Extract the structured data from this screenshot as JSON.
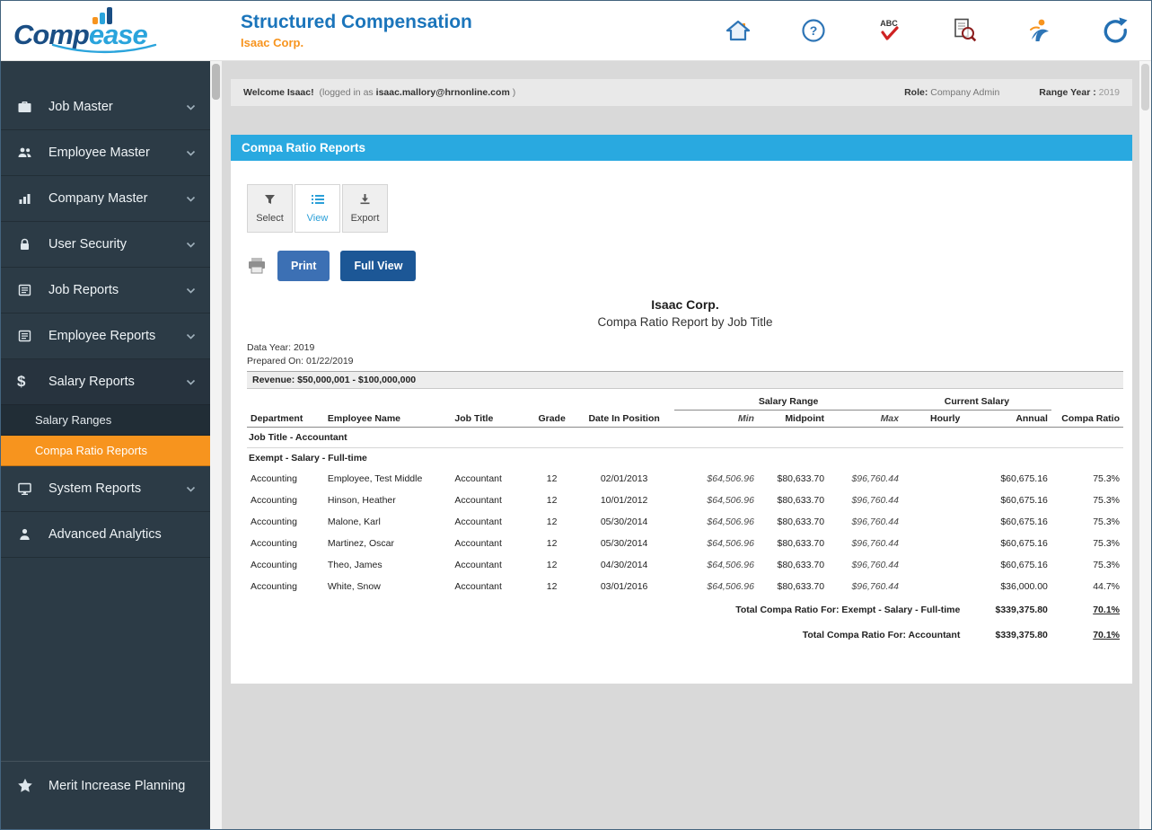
{
  "header": {
    "logo_part1": "Comp",
    "logo_part2": "ease",
    "app_title": "Structured Compensation",
    "company": "Isaac Corp."
  },
  "icons": {
    "dollar_glyph": "$",
    "question_glyph": "?",
    "abc_glyph": "ABC"
  },
  "sidebar": {
    "items": [
      {
        "label": "Job Master",
        "icon": "briefcase-icon"
      },
      {
        "label": "Employee Master",
        "icon": "people-icon"
      },
      {
        "label": "Company Master",
        "icon": "bar-chart-icon"
      },
      {
        "label": "User Security",
        "icon": "lock-icon"
      },
      {
        "label": "Job Reports",
        "icon": "report-icon"
      },
      {
        "label": "Employee Reports",
        "icon": "report-icon"
      },
      {
        "label": "Salary Reports",
        "icon": "dollar-icon",
        "expanded": true,
        "children": [
          {
            "label": "Salary Ranges",
            "active": false
          },
          {
            "label": "Compa Ratio Reports",
            "active": true
          }
        ]
      },
      {
        "label": "System Reports",
        "icon": "monitor-icon"
      },
      {
        "label": "Advanced Analytics",
        "icon": "person-icon"
      }
    ],
    "footer_item": {
      "label": "Merit Increase Planning",
      "icon": "star-icon"
    }
  },
  "welcome_bar": {
    "welcome": "Welcome Isaac!",
    "logged_in_prefix": "(logged in as",
    "email": "isaac.mallory@hrnonline.com",
    "logged_in_suffix": ")",
    "role_label": "Role:",
    "role_value": "Company Admin",
    "range_year_label": "Range Year :",
    "range_year_value": "2019"
  },
  "page": {
    "title": "Compa Ratio Reports",
    "tabs": [
      {
        "label": "Select",
        "icon": "filter-icon",
        "active": false
      },
      {
        "label": "View",
        "icon": "list-icon",
        "active": true
      },
      {
        "label": "Export",
        "icon": "download-icon",
        "active": false
      }
    ],
    "print_button": "Print",
    "full_view_button": "Full View"
  },
  "report": {
    "company": "Isaac Corp.",
    "title": "Compa Ratio Report by Job Title",
    "data_year": "Data Year: 2019",
    "prepared_on": "Prepared On: 01/22/2019",
    "revenue_band": "Revenue: $50,000,001 - $100,000,000",
    "group_headers": {
      "salary_range": "Salary Range",
      "current_salary": "Current Salary"
    },
    "columns": [
      "Department",
      "Employee Name",
      "Job Title",
      "Grade",
      "Date In Position",
      "Min",
      "Midpoint",
      "Max",
      "Hourly",
      "Annual",
      "Compa Ratio"
    ],
    "job_title_group": "Job Title - Accountant",
    "subgroup": "Exempt - Salary - Full-time",
    "rows": [
      {
        "department": "Accounting",
        "employee": "Employee, Test Middle",
        "job_title": "Accountant",
        "grade": "12",
        "date_in_position": "02/01/2013",
        "min": "$64,506.96",
        "midpoint": "$80,633.70",
        "max": "$96,760.44",
        "hourly": "",
        "annual": "$60,675.16",
        "compa_ratio": "75.3%"
      },
      {
        "department": "Accounting",
        "employee": "Hinson, Heather",
        "job_title": "Accountant",
        "grade": "12",
        "date_in_position": "10/01/2012",
        "min": "$64,506.96",
        "midpoint": "$80,633.70",
        "max": "$96,760.44",
        "hourly": "",
        "annual": "$60,675.16",
        "compa_ratio": "75.3%"
      },
      {
        "department": "Accounting",
        "employee": "Malone, Karl",
        "job_title": "Accountant",
        "grade": "12",
        "date_in_position": "05/30/2014",
        "min": "$64,506.96",
        "midpoint": "$80,633.70",
        "max": "$96,760.44",
        "hourly": "",
        "annual": "$60,675.16",
        "compa_ratio": "75.3%"
      },
      {
        "department": "Accounting",
        "employee": "Martinez, Oscar",
        "job_title": "Accountant",
        "grade": "12",
        "date_in_position": "05/30/2014",
        "min": "$64,506.96",
        "midpoint": "$80,633.70",
        "max": "$96,760.44",
        "hourly": "",
        "annual": "$60,675.16",
        "compa_ratio": "75.3%"
      },
      {
        "department": "Accounting",
        "employee": "Theo, James",
        "job_title": "Accountant",
        "grade": "12",
        "date_in_position": "04/30/2014",
        "min": "$64,506.96",
        "midpoint": "$80,633.70",
        "max": "$96,760.44",
        "hourly": "",
        "annual": "$60,675.16",
        "compa_ratio": "75.3%"
      },
      {
        "department": "Accounting",
        "employee": "White, Snow",
        "job_title": "Accountant",
        "grade": "12",
        "date_in_position": "03/01/2016",
        "min": "$64,506.96",
        "midpoint": "$80,633.70",
        "max": "$96,760.44",
        "hourly": "",
        "annual": "$36,000.00",
        "compa_ratio": "44.7%"
      }
    ],
    "totals": [
      {
        "label": "Total Compa Ratio For: Exempt - Salary - Full-time",
        "annual": "$339,375.80",
        "compa_ratio": "70.1%"
      },
      {
        "label": "Total Compa Ratio For: Accountant",
        "annual": "$339,375.80",
        "compa_ratio": "70.1%"
      }
    ]
  },
  "colors": {
    "brand_blue": "#1b75bb",
    "accent_light_blue": "#29a9e0",
    "brand_orange": "#f7941e",
    "sidebar_bg": "#2c3b46",
    "active_nav_orange": "#f7941e",
    "print_button_blue": "#3c70b4",
    "full_view_button_blue": "#1c5796"
  }
}
